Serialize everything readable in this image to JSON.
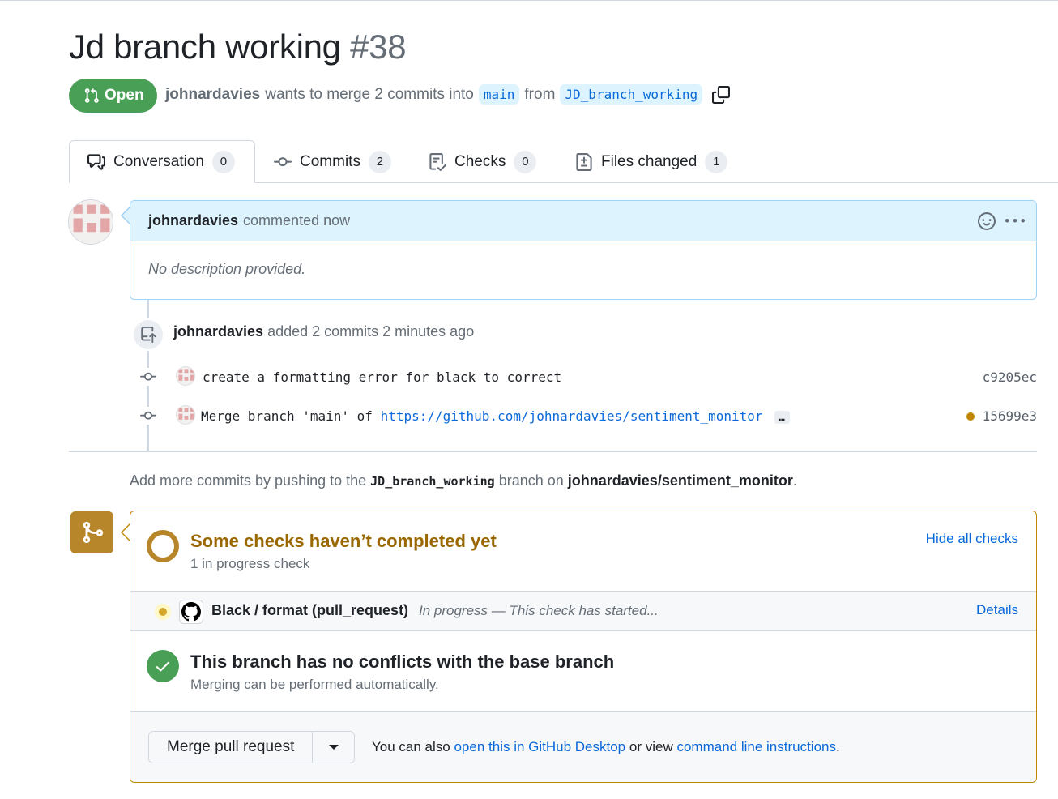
{
  "pr": {
    "title": "Jd branch working",
    "number": "#38",
    "state": "Open",
    "author": "johnardavies",
    "meta_text_1": "wants to merge 2 commits into",
    "base_branch": "main",
    "meta_text_2": "from",
    "head_branch": "JD_branch_working"
  },
  "tabs": [
    {
      "label": "Conversation",
      "count": "0"
    },
    {
      "label": "Commits",
      "count": "2"
    },
    {
      "label": "Checks",
      "count": "0"
    },
    {
      "label": "Files changed",
      "count": "1"
    }
  ],
  "comment": {
    "author": "johnardavies",
    "action": "commented now",
    "body": "No description provided."
  },
  "push_event": {
    "author": "johnardavies",
    "text": "added 2 commits 2 minutes ago"
  },
  "commits": [
    {
      "message": "create a formatting error for black to correct",
      "link": "",
      "sha": "c9205ec"
    },
    {
      "message": "Merge branch 'main' of ",
      "link": "https://github.com/johnardavies/sentiment_monitor",
      "ellipsis": "…",
      "sha": "15699e3"
    }
  ],
  "add_more": {
    "prefix": "Add more commits by pushing to the",
    "branch": "JD_branch_working",
    "middle": "branch on",
    "repo": "johnardavies/sentiment_monitor",
    "suffix": "."
  },
  "checks": {
    "title": "Some checks haven’t completed yet",
    "subtitle": "1 in progress check",
    "hide_label": "Hide all checks",
    "items": [
      {
        "name": "Black / format (pull_request)",
        "status": "In progress — This check has started...",
        "details_label": "Details"
      }
    ]
  },
  "conflicts": {
    "title": "This branch has no conflicts with the base branch",
    "subtitle": "Merging can be performed automatically."
  },
  "merge": {
    "button_label": "Merge pull request",
    "hint_prefix": "You can also",
    "hint_link_1": "open this in GitHub Desktop",
    "hint_middle": "or view",
    "hint_link_2": "command line instructions",
    "hint_suffix": "."
  },
  "colors": {
    "open_green": "#4a9f56",
    "link_blue": "#0969da",
    "pending_gold": "#bf8700",
    "comment_header": "#ddf4ff"
  },
  "icons": [
    "git-pull-request-icon",
    "copy-icon",
    "conversation-icon",
    "commit-icon",
    "checklist-icon",
    "file-diff-icon",
    "smiley-icon",
    "kebab-icon",
    "repo-push-icon",
    "git-merge-icon",
    "github-logo-icon",
    "check-icon",
    "triangle-down-icon"
  ]
}
